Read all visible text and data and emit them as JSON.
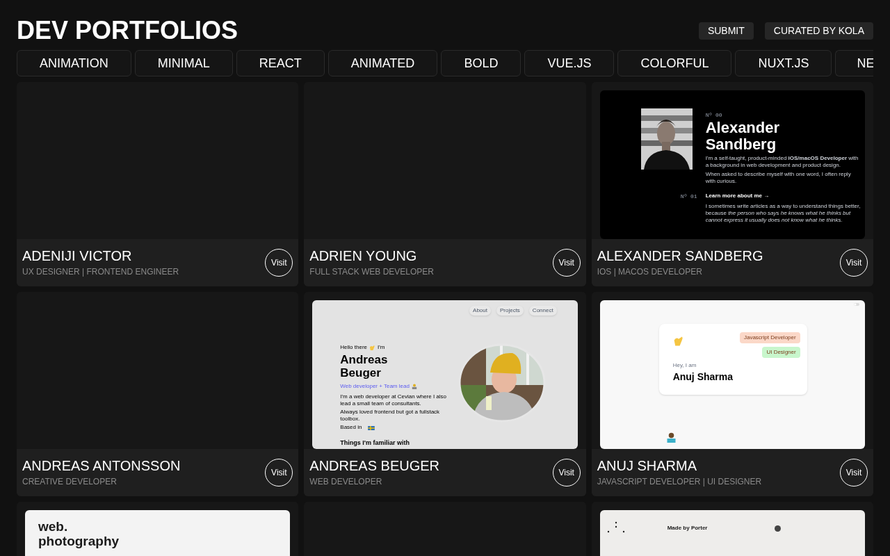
{
  "header": {
    "title": "DEV PORTFOLIOS",
    "buttons": [
      "SUBMIT",
      "CURATED BY KOLA"
    ]
  },
  "tabs": [
    {
      "label": "ANIMATION",
      "selected": false
    },
    {
      "label": "MINIMAL",
      "selected": false
    },
    {
      "label": "REACT",
      "selected": false
    },
    {
      "label": "ANIMATED",
      "selected": false
    },
    {
      "label": "BOLD",
      "selected": false
    },
    {
      "label": "VUE.JS",
      "selected": false
    },
    {
      "label": "COLORFUL",
      "selected": false
    },
    {
      "label": "NUXT.JS",
      "selected": false
    },
    {
      "label": "NE",
      "selected": false
    }
  ],
  "cards": [
    {
      "kind": "profile",
      "name": "ADENIJI VICTOR",
      "role": "UX DESIGNER | FRONTEND ENGINEER",
      "button": "Visit"
    },
    {
      "kind": "profile",
      "name": "ADRIEN YOUNG",
      "role": "FULL STACK WEB DEVELOPER",
      "button": "Visit"
    },
    {
      "kind": "profile",
      "name": "ALEXANDER SANDBERG",
      "role": "IOS | MACOS DEVELOPER",
      "button": "Visit",
      "thumbnail": {
        "kind": "dark-profile",
        "number_top": "Nº 00",
        "title_lines": [
          "Alexander",
          "Sandberg"
        ],
        "paragraphs": [
          "I'm a self-taught, product-minded **iOS/macOS Developer** with a background in web development and product design.",
          "When asked to describe myself with one word, I often reply with curious."
        ],
        "number_link": "Nº 01",
        "link": "Learn more about me →",
        "article": "I sometimes write articles as a way to understand things better, because *the person who says he knows what he thinks but cannot express it usually does not know what he thinks.*"
      }
    },
    {
      "kind": "profile",
      "name": "ANDREAS ANTONSSON",
      "role": "CREATIVE DEVELOPER",
      "button": "Visit"
    },
    {
      "kind": "profile",
      "name": "ANDREAS BEUGER",
      "role": "WEB DEVELOPER",
      "button": "Visit",
      "thumbnail": {
        "kind": "circle-hero",
        "nav": [
          "About",
          "Projects",
          "Connect"
        ],
        "greeting": [
          "Hello there",
          "I'm"
        ],
        "title_lines": [
          "Andreas",
          "Beuger"
        ],
        "tagline": "Web developer + Team lead",
        "paragraphs": [
          "I'm a web developer at Cevian where I also lead a small team of consultants.",
          "Always loved frontend but got a fullstack toolbox.",
          "Based in"
        ],
        "section": "Things I'm familiar with"
      }
    },
    {
      "kind": "profile",
      "name": "ANUJ SHARMA",
      "role": "JAVASCRIPT DEVELOPER | UI DESIGNER",
      "button": "Visit",
      "thumbnail": {
        "kind": "card-hero",
        "tags": [
          {
            "label": "Javascript Developer",
            "color": "#fbd8c8"
          },
          {
            "label": "UI Designer",
            "color": "#c8f6cc"
          }
        ],
        "greeting": "Hey, I am",
        "title": "Anuj Sharma"
      }
    },
    {
      "kind": "preview",
      "thumbnail": {
        "kind": "text-hero",
        "title_lines": [
          "web.",
          "photography"
        ]
      }
    },
    {
      "kind": "preview"
    },
    {
      "kind": "preview",
      "thumbnail": {
        "kind": "dots-hero",
        "title": "Made by Porter"
      }
    }
  ]
}
